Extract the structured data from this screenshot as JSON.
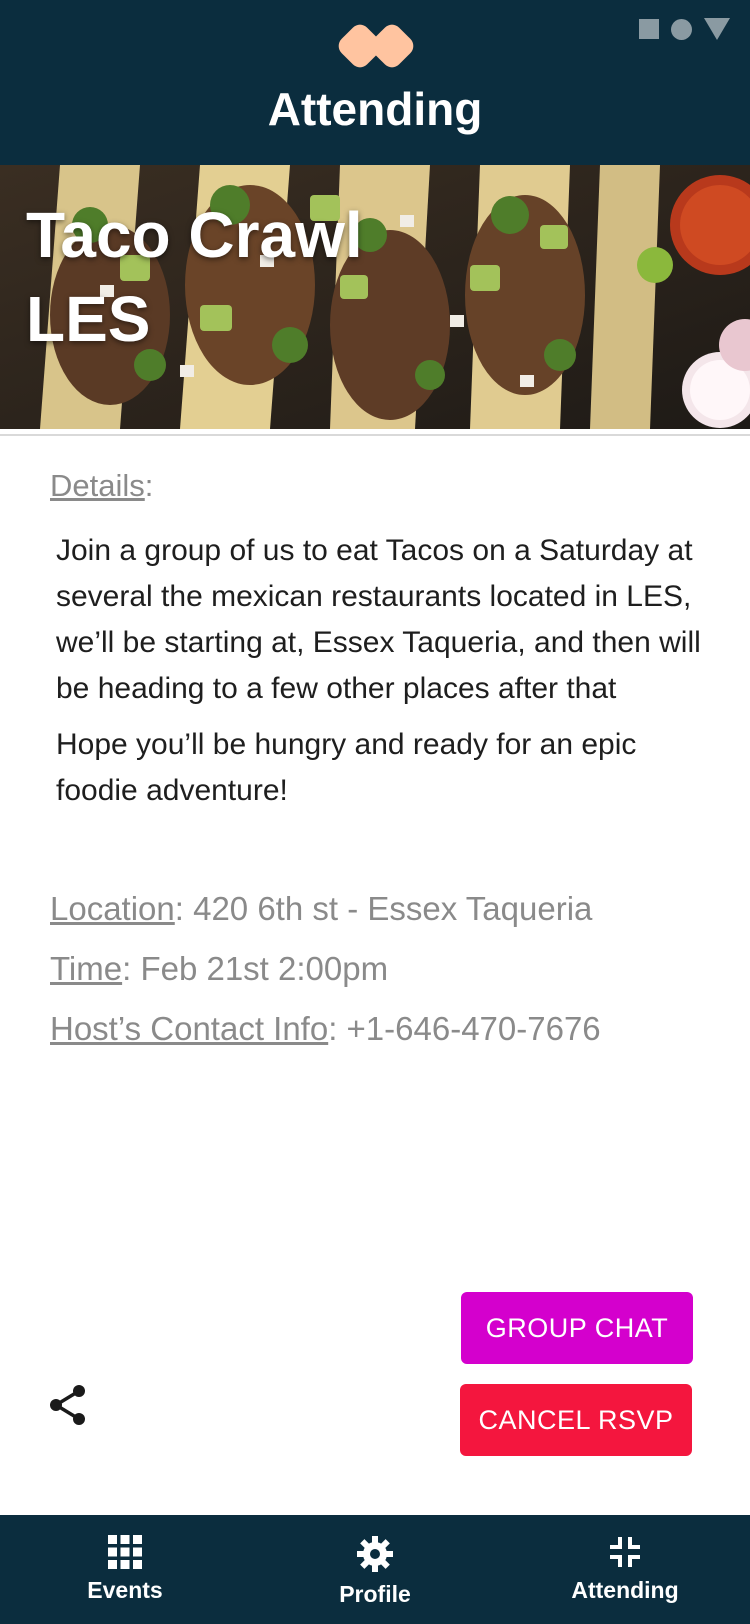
{
  "header": {
    "title": "Attending"
  },
  "event": {
    "title_line1": "Taco Crawl",
    "title_line2": "LES"
  },
  "details": {
    "label": "Details",
    "paragraph1": "Join a group of us to eat Tacos on a Saturday at several the mexican restaurants located in LES, we’ll be starting at, Essex Taqueria, and then will be heading to a few other places after that",
    "paragraph2": "Hope you’ll be hungry and ready for an epic foodie adventure!"
  },
  "info": {
    "location_label": "Location",
    "location_value": ": 420 6th st - Essex Taqueria",
    "time_label": "Time",
    "time_value": ": Feb 21st 2:00pm",
    "contact_label": "Host’s Contact Info",
    "contact_value": ": +1-646-470-7676"
  },
  "actions": {
    "group_chat": "GROUP CHAT",
    "cancel_rsvp": "CANCEL RSVP"
  },
  "nav": {
    "events": "Events",
    "profile": "Profile",
    "attending": "Attending"
  },
  "colors": {
    "header_bg": "#0b2d3e",
    "logo": "#ffc4a0",
    "group_chat": "#d400cd",
    "cancel_rsvp": "#f4163e",
    "muted_text": "#8a8a8a"
  },
  "icons": {
    "logo": "peach-double-circle-logo",
    "share": "share-icon",
    "events": "grid-icon",
    "profile": "gear-icon",
    "attending": "collapse-icon"
  }
}
